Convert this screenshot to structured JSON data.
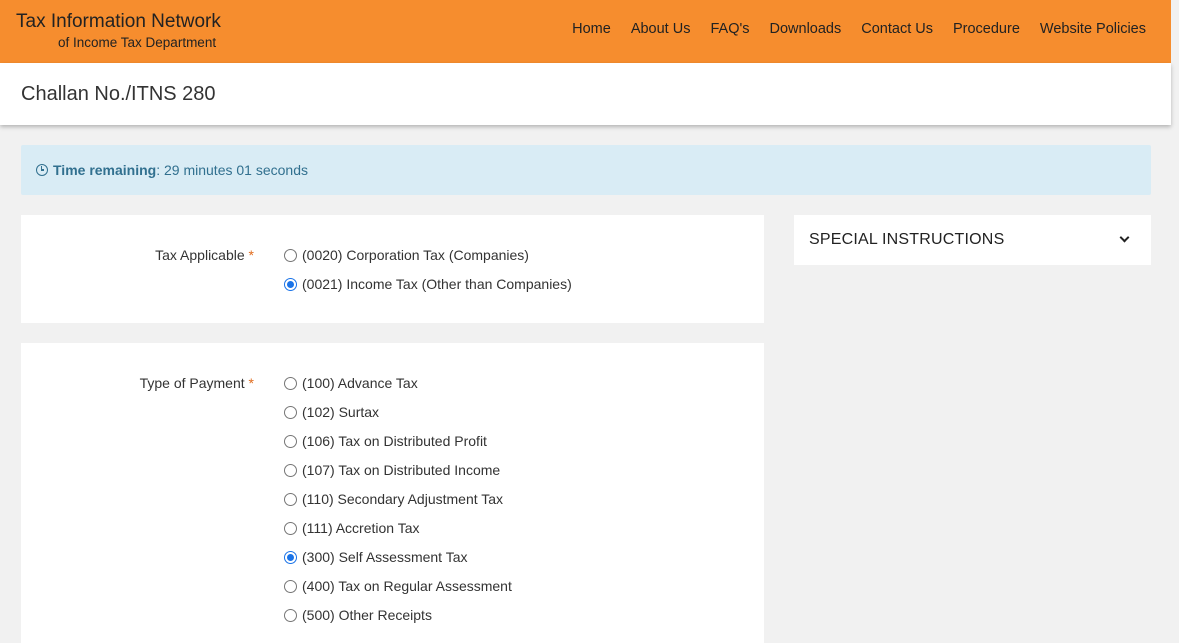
{
  "header": {
    "brand_title": "Tax Information Network",
    "brand_subtitle": "of Income Tax Department",
    "nav": [
      "Home",
      "About Us",
      "FAQ's",
      "Downloads",
      "Contact Us",
      "Procedure",
      "Website Policies"
    ],
    "background_color": "#f68d2e"
  },
  "page_title": "Challan No./ITNS 280",
  "timer": {
    "label": "Time remaining",
    "separator": ":",
    "value": "29 minutes 01 seconds",
    "icon": "clock-icon"
  },
  "tax_applicable": {
    "label": "Tax Applicable",
    "required_mark": "*",
    "options": [
      {
        "text": "(0020) Corporation Tax (Companies)",
        "checked": false
      },
      {
        "text": "(0021) Income Tax (Other than Companies)",
        "checked": true
      }
    ]
  },
  "type_of_payment": {
    "label": "Type of Payment",
    "required_mark": "*",
    "options": [
      {
        "text": "(100) Advance Tax",
        "checked": false
      },
      {
        "text": "(102) Surtax",
        "checked": false
      },
      {
        "text": "(106) Tax on Distributed Profit",
        "checked": false
      },
      {
        "text": "(107) Tax on Distributed Income",
        "checked": false
      },
      {
        "text": "(110) Secondary Adjustment Tax",
        "checked": false
      },
      {
        "text": "(111) Accretion Tax",
        "checked": false
      },
      {
        "text": "(300) Self Assessment Tax",
        "checked": true
      },
      {
        "text": "(400) Tax on Regular Assessment",
        "checked": false
      },
      {
        "text": "(500) Other Receipts",
        "checked": false
      }
    ]
  },
  "special_instructions": {
    "label": "SPECIAL INSTRUCTIONS",
    "icon": "chevron-down-icon"
  }
}
